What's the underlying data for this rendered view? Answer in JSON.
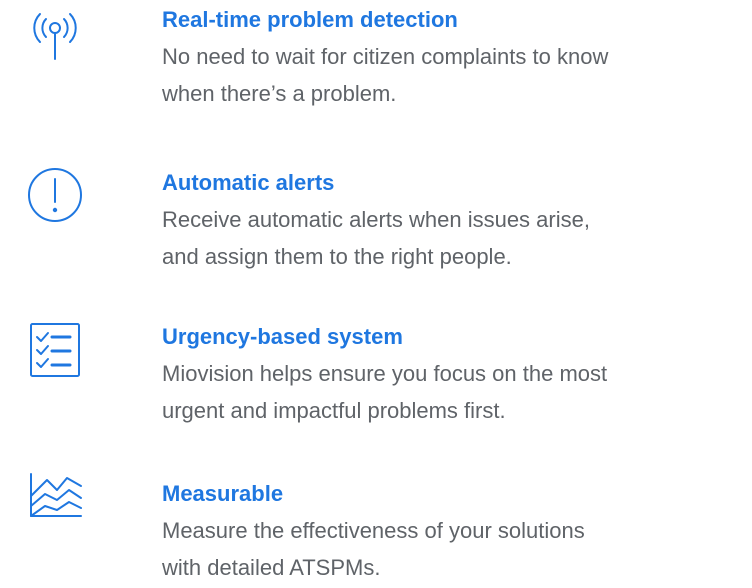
{
  "accent_color": "#1f77e0",
  "features": [
    {
      "icon": "broadcast-antenna-icon",
      "title": "Real-time problem detection",
      "description": "No need to wait for citizen complaints to know\nwhen there’s a problem."
    },
    {
      "icon": "alert-exclamation-icon",
      "title": "Automatic alerts",
      "description": "Receive automatic alerts when issues arise,\nand assign them to the right people."
    },
    {
      "icon": "checklist-icon",
      "title": "Urgency-based system",
      "description": "Miovision helps ensure you focus on the most\nurgent and impactful problems first."
    },
    {
      "icon": "area-chart-icon",
      "title": "Measurable",
      "description": "Measure the effectiveness of your solutions\nwith detailed ATSPMs."
    }
  ]
}
